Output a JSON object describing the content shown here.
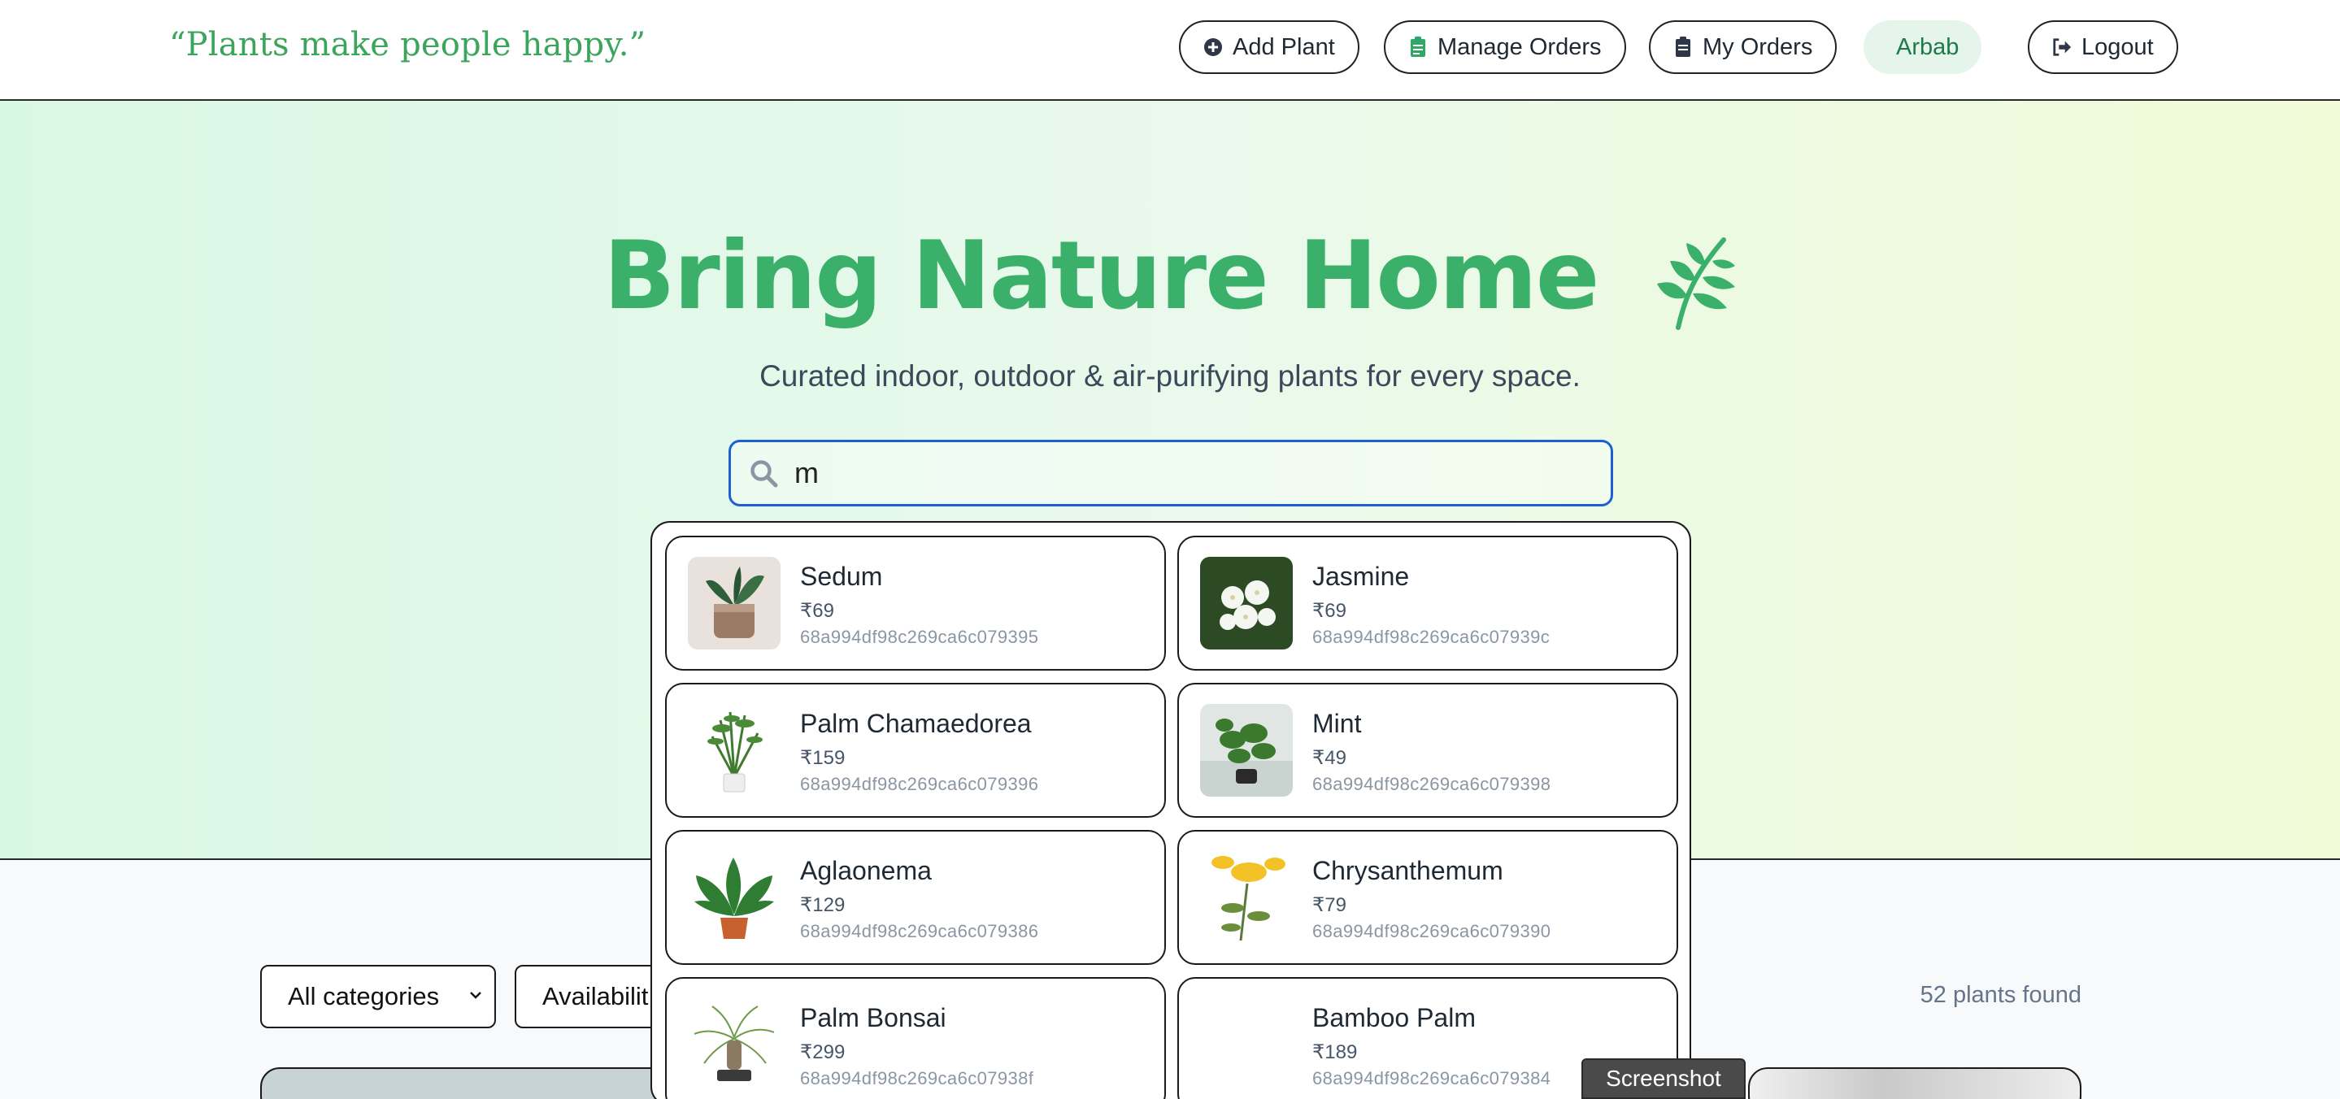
{
  "header": {
    "tagline": "“Plants make people happy.”",
    "nav": {
      "add_plant": "Add Plant",
      "manage_orders": "Manage Orders",
      "my_orders": "My Orders",
      "user": "Arbab",
      "logout": "Logout"
    }
  },
  "hero": {
    "title": "Bring Nature Home",
    "subtitle": "Curated indoor, outdoor & air-purifying plants for every space."
  },
  "search": {
    "value": "m",
    "placeholder": ""
  },
  "results": [
    {
      "name": "Sedum",
      "price": "₹69",
      "id": "68a994df98c269ca6c079395"
    },
    {
      "name": "Jasmine",
      "price": "₹69",
      "id": "68a994df98c269ca6c07939c"
    },
    {
      "name": "Palm Chamaedorea",
      "price": "₹159",
      "id": "68a994df98c269ca6c079396"
    },
    {
      "name": "Mint",
      "price": "₹49",
      "id": "68a994df98c269ca6c079398"
    },
    {
      "name": "Aglaonema",
      "price": "₹129",
      "id": "68a994df98c269ca6c079386"
    },
    {
      "name": "Chrysanthemum",
      "price": "₹79",
      "id": "68a994df98c269ca6c079390"
    },
    {
      "name": "Palm Bonsai",
      "price": "₹299",
      "id": "68a994df98c269ca6c07938f"
    },
    {
      "name": "Bamboo Palm",
      "price": "₹189",
      "id": "68a994df98c269ca6c079384"
    }
  ],
  "filters": {
    "category": "All categories",
    "availability": "Availabilit"
  },
  "count_text": "52 plants found",
  "screenshot_label": "Screenshot",
  "colors": {
    "accent_green": "#3bb06a",
    "search_border": "#1f5fd6"
  }
}
